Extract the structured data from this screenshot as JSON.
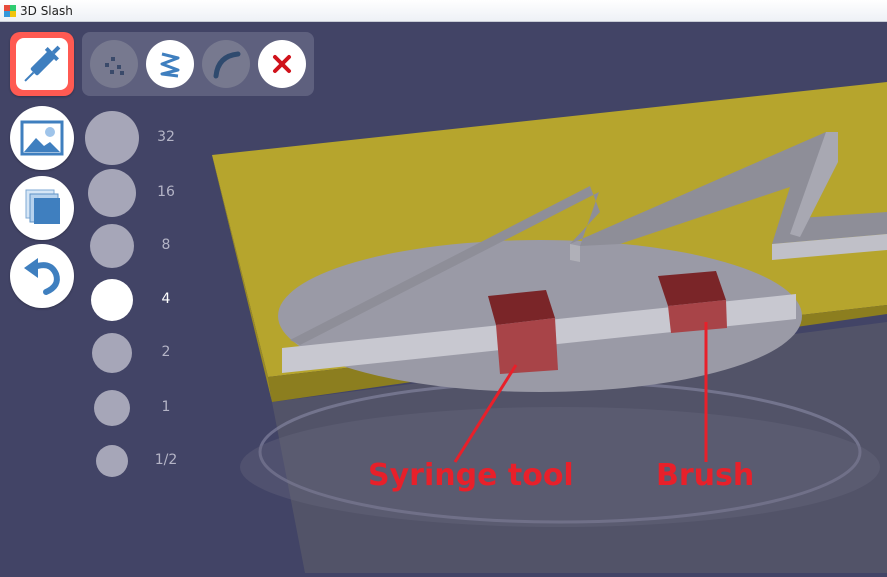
{
  "window": {
    "title": "3D Slash",
    "icon": "colored-pixel-icon"
  },
  "toolbar": {
    "tools": [
      {
        "name": "syringe-tool",
        "icon": "syringe-icon",
        "active": true
      },
      {
        "name": "image-tool",
        "icon": "image-icon",
        "active": false
      },
      {
        "name": "cube-tool",
        "icon": "cube-icon",
        "active": false
      },
      {
        "name": "undo-tool",
        "icon": "undo-icon",
        "active": false
      }
    ]
  },
  "subtools": [
    {
      "name": "dots-option",
      "icon": "dots-icon"
    },
    {
      "name": "zigzag-option",
      "icon": "zigzag-icon"
    },
    {
      "name": "curve-option",
      "icon": "curve-icon"
    },
    {
      "name": "close-option",
      "icon": "close-icon"
    }
  ],
  "brush_sizes": {
    "options": [
      "32",
      "16",
      "8",
      "4",
      "2",
      "1",
      "1/2"
    ],
    "selected": "4"
  },
  "annotations": {
    "syringe_label": "Syringe tool",
    "brush_label": "Brush"
  },
  "colors": {
    "background": "#424466",
    "active_tool": "#ff5a52",
    "plate_yellow": "#b6a52d",
    "annotation_red": "#e8202a"
  }
}
